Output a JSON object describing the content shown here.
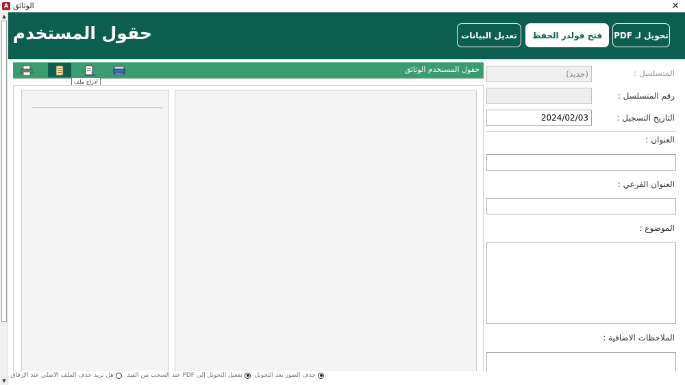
{
  "window": {
    "title": "الوثائق",
    "close_glyph": "✕",
    "app_icon_letter": "A"
  },
  "header": {
    "title": "حقول المستخدم",
    "buttons": {
      "to_pdf": "تحويل لـ PDF",
      "open_folder": "فتح فولدر الحفظ",
      "edit_data": "تعديل البيانات"
    },
    "colors": {
      "primary": "#0c5e4f",
      "toolbar": "#3a9c70"
    }
  },
  "form": {
    "serial": {
      "label": "المتسلسل :",
      "value": "(جديد)"
    },
    "serial_number": {
      "label": "رقم المتسلسل :",
      "value": ""
    },
    "registration_date": {
      "label": "التاريخ التسجيل :",
      "value": "2024/02/03"
    },
    "title": {
      "label": "العنوان :",
      "value": ""
    },
    "subtitle": {
      "label": "العنوان الفرعي :",
      "value": ""
    },
    "subject": {
      "label": "الموضوع :",
      "value": ""
    },
    "notes": {
      "label": "الملاحظات الاضافية :",
      "value": ""
    }
  },
  "toolbar": {
    "title": "حقول المستخدم الوثائق",
    "icons": [
      "printer-icon",
      "document-icon",
      "insert-file-icon",
      "scanner-icon"
    ],
    "tooltip": "ادراج ملف"
  },
  "status": {
    "delete_images": "حذف الصور بعد التحويل",
    "enable_pdf_drag": "تفعيل التحويل إلى PDF عند السحب من الفيد",
    "delete_original": "هل تريد حذف الملف الاصلي عند الإرفاق"
  }
}
